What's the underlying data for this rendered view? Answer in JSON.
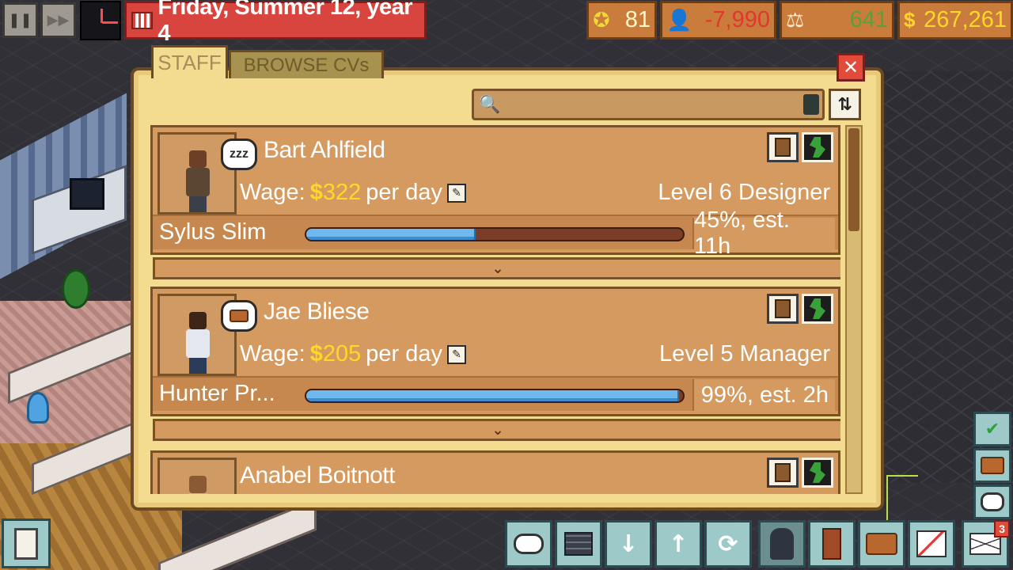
{
  "topbar": {
    "date": "Friday, Summer 12, year 4",
    "reputation": "81",
    "debt": "-7,990",
    "legal": "641",
    "money": "267,261"
  },
  "tabs": [
    {
      "label": "STAFF",
      "active": true
    },
    {
      "label": "BROWSE CVs",
      "active": false
    }
  ],
  "search": {
    "value": "",
    "placeholder": ""
  },
  "staff": [
    {
      "name": "Bart Ahlfield",
      "status": "zzz",
      "wage_label": "Wage:",
      "wage_amount": "322",
      "wage_suffix": "per day",
      "level": "Level 6 Designer",
      "task": "Sylus Slim",
      "progress": 0.45,
      "progress_text": "45%, est. 11h"
    },
    {
      "name": "Jae Bliese",
      "status": "briefcase",
      "wage_label": "Wage:",
      "wage_amount": "205",
      "wage_suffix": "per day",
      "level": "Level 5 Manager",
      "task": "Hunter Pr...",
      "progress": 0.99,
      "progress_text": "99%, est. 2h"
    },
    {
      "name": "Anabel Boitnott"
    }
  ],
  "bottombar": {
    "mail_count": "3"
  },
  "colors": {
    "panel": "#f3dc8f",
    "card": "#d59a5f",
    "money": "#ffd72a",
    "debt": "#e0382d",
    "progress": "#6fb9ef"
  }
}
